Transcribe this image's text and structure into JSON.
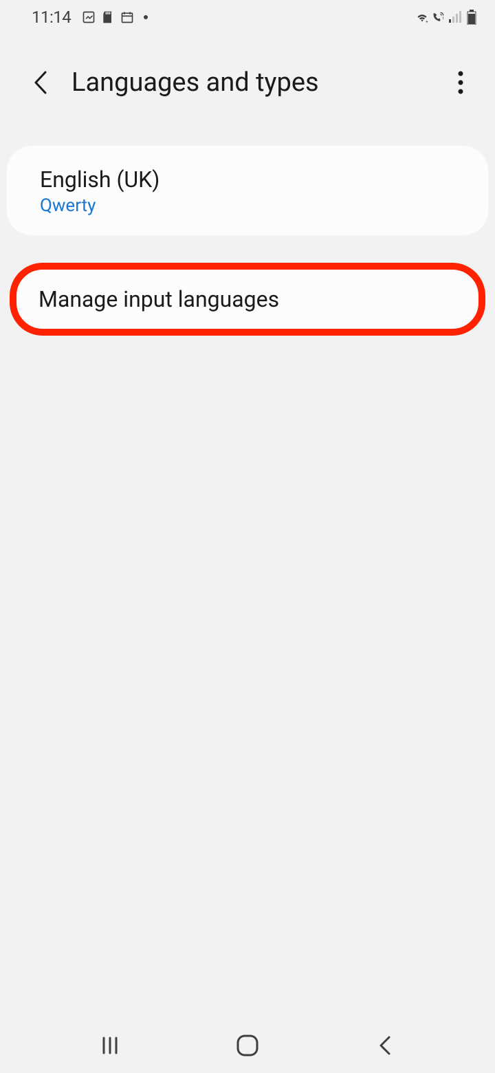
{
  "status": {
    "time": "11:14"
  },
  "header": {
    "title": "Languages and types"
  },
  "language_card": {
    "title": "English (UK)",
    "subtitle": "Qwerty"
  },
  "manage_card": {
    "title": "Manage input languages"
  }
}
